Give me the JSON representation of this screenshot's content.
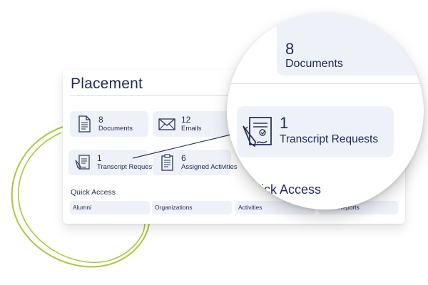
{
  "colors": {
    "accent_green": "#a8c93a",
    "tile_bg": "#eef1f8",
    "text_navy": "#1f2b55",
    "icon_stroke": "#2a3558"
  },
  "card": {
    "title": "Placement",
    "tiles": [
      {
        "count": "8",
        "label": "Documents",
        "icon": "document-icon"
      },
      {
        "count": "12",
        "label": "Emails",
        "icon": "envelope-icon"
      },
      {
        "count": "1",
        "label": "Transcript Requests",
        "icon": "transcript-icon"
      },
      {
        "count": "6",
        "label": "Assigned Activities",
        "icon": "clipboard-icon"
      }
    ],
    "quick_access": {
      "title": "Quick Access",
      "items": [
        "Alumni",
        "Organizations",
        "Activities",
        "Reports"
      ]
    }
  },
  "magnifier": {
    "top_count": "8",
    "top_label": "Documents",
    "tile": {
      "count": "1",
      "label": "Transcript Requests",
      "icon": "transcript-icon"
    },
    "quick_access_title": "Quick Access"
  }
}
